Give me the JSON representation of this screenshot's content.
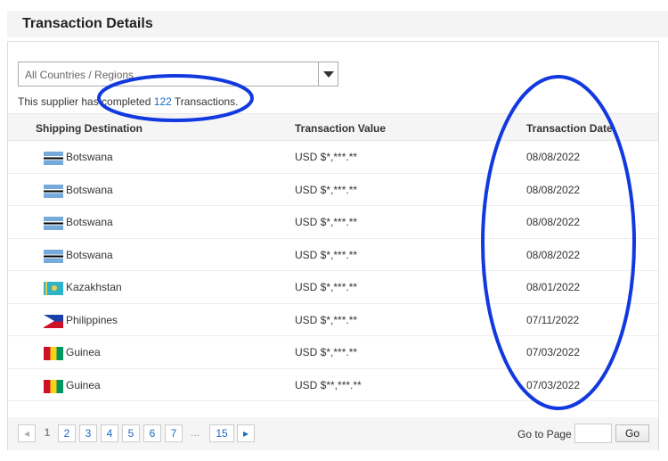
{
  "title": "Transaction Details",
  "filter": {
    "selected": "All Countries / Regions"
  },
  "summary": {
    "prefix": "This supplier has completed",
    "count": "122",
    "suffix": "Transactions."
  },
  "columns": [
    "Shipping Destination",
    "Transaction Value",
    "Transaction Date"
  ],
  "rows": [
    {
      "country": "Botswana",
      "flag": "botswana",
      "value": "USD $*,***.**",
      "date": "08/08/2022"
    },
    {
      "country": "Botswana",
      "flag": "botswana",
      "value": "USD $*,***.**",
      "date": "08/08/2022"
    },
    {
      "country": "Botswana",
      "flag": "botswana",
      "value": "USD $*,***.**",
      "date": "08/08/2022"
    },
    {
      "country": "Botswana",
      "flag": "botswana",
      "value": "USD $*,***.**",
      "date": "08/08/2022"
    },
    {
      "country": "Kazakhstan",
      "flag": "kazakhstan",
      "value": "USD $*,***.**",
      "date": "08/01/2022"
    },
    {
      "country": "Philippines",
      "flag": "philippines",
      "value": "USD $*,***.**",
      "date": "07/11/2022"
    },
    {
      "country": "Guinea",
      "flag": "guinea",
      "value": "USD $*,***.**",
      "date": "07/03/2022"
    },
    {
      "country": "Guinea",
      "flag": "guinea",
      "value": "USD $**,***.**",
      "date": "07/03/2022"
    }
  ],
  "pagination": {
    "prev": "◂",
    "current": "1",
    "pages": [
      "2",
      "3",
      "4",
      "5",
      "6",
      "7"
    ],
    "ellipsis": "...",
    "last": "15",
    "next": "▸",
    "goto_label": "Go to Page",
    "go_button": "Go",
    "goto_value": ""
  },
  "annotation_color": "#1238e0"
}
